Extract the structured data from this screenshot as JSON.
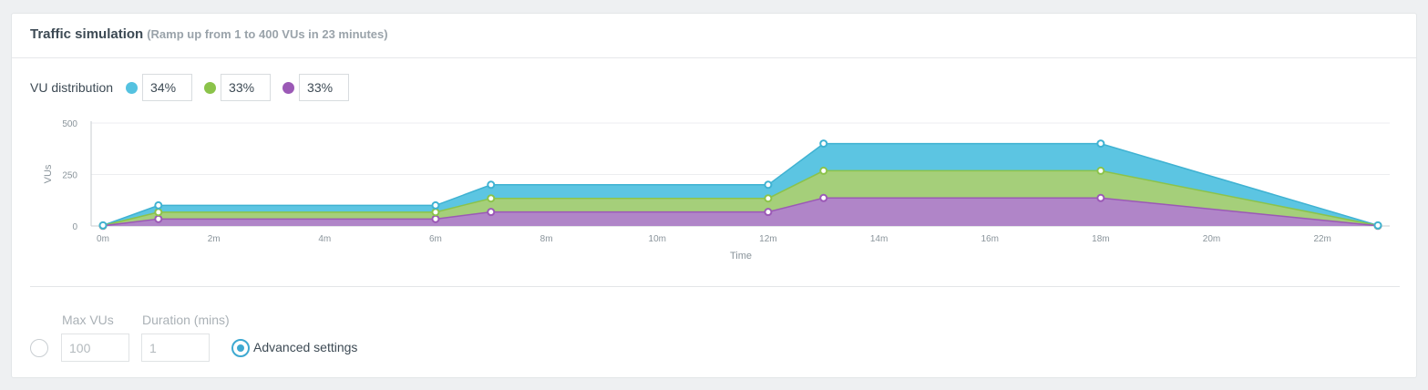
{
  "header": {
    "title": "Traffic simulation",
    "subtitle": "(Ramp up from 1 to 400 VUs in 23 minutes)"
  },
  "distribution": {
    "label": "VU distribution",
    "items": [
      {
        "color": "#55c2e0",
        "value": "34%"
      },
      {
        "color": "#8bc34a",
        "value": "33%"
      },
      {
        "color": "#9b59b6",
        "value": "33%"
      }
    ]
  },
  "chart_data": {
    "type": "area",
    "stacked": true,
    "xlabel": "Time",
    "ylabel": "VUs",
    "x": [
      0,
      1,
      6,
      7,
      12,
      13,
      18,
      23
    ],
    "xticks": [
      "0m",
      "2m",
      "4m",
      "6m",
      "8m",
      "10m",
      "12m",
      "14m",
      "16m",
      "18m",
      "20m",
      "22m"
    ],
    "xtick_values": [
      0,
      2,
      4,
      6,
      8,
      10,
      12,
      14,
      16,
      18,
      20,
      22
    ],
    "xlim": [
      0,
      23
    ],
    "yticks": [
      "0",
      "250",
      "500"
    ],
    "ytick_values": [
      0,
      250,
      500
    ],
    "ylim": [
      0,
      500
    ],
    "grid": true,
    "series": [
      {
        "color": "#b085c8",
        "stroke": "#9b59b6",
        "values": [
          1,
          34,
          34,
          68,
          68,
          136,
          136,
          1
        ]
      },
      {
        "color": "#a5cf7a",
        "stroke": "#8bc34a",
        "values": [
          1,
          33,
          33,
          66,
          66,
          132,
          132,
          1
        ]
      },
      {
        "color": "#5cc5e2",
        "stroke": "#3fb2d2",
        "values": [
          1,
          33,
          33,
          66,
          66,
          132,
          132,
          1
        ]
      }
    ]
  },
  "settings": {
    "max_vus_label": "Max VUs",
    "max_vus_value": "100",
    "duration_label": "Duration (mins)",
    "duration_value": "1",
    "advanced_label": "Advanced settings"
  }
}
